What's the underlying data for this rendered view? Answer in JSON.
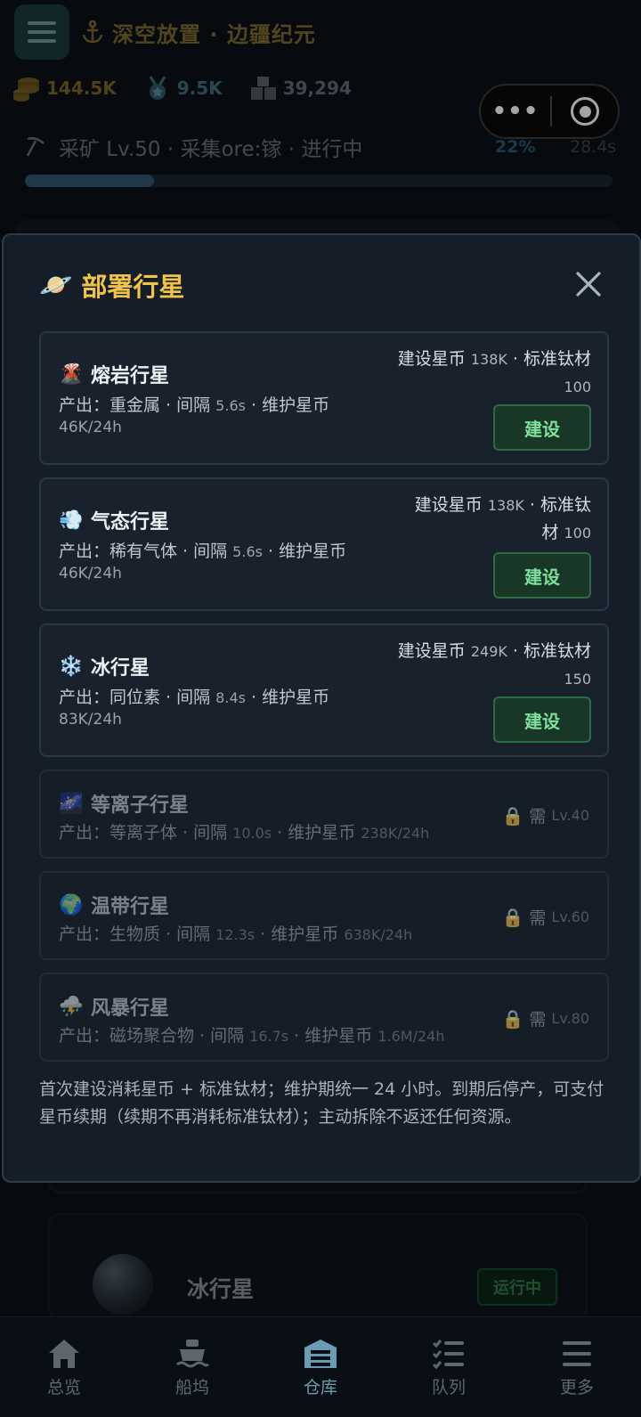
{
  "header": {
    "title": "深空放置 · 边疆纪元",
    "menu_icon": "menu-icon",
    "anchor_icon": "anchor-icon"
  },
  "resources": {
    "coins": "144.5K",
    "medals": "9.5K",
    "materials": "39,294"
  },
  "mini_capsule": {
    "more": "•••"
  },
  "mining": {
    "text": "采矿 Lv.50 · 采集ore:镓 · 进行中",
    "percent_label": "22%",
    "progress": 0.22,
    "time": "28.4s"
  },
  "modal": {
    "title": "部署行星",
    "title_icon": "🪐",
    "build_label": "建设",
    "footnote": "首次建设消耗星币 + 标准钛材；维护期统一 24 小时。到期后停产，可支付星币续期（续期不再消耗标准钛材）；主动拆除不返还任何资源。",
    "planets": [
      {
        "emoji": "🌋",
        "name": "熔岩行星",
        "output_prefix": "产出：重金属 · 间隔 ",
        "interval": "5.6s",
        "output_mid": " · 维护星币",
        "maintenance": "46K/24h",
        "cost_line1_a": "建设星币 ",
        "cost_line1_num": "138K",
        "cost_line1_b": " · 标准钛材",
        "cost_line2_a": "",
        "cost_line2_num": "100"
      },
      {
        "emoji": "💨",
        "name": "气态行星",
        "output_prefix": "产出：稀有气体 · 间隔 ",
        "interval": "5.6s",
        "output_mid": " · 维护星币",
        "maintenance": "46K/24h",
        "cost_line1_a": "建设星币 ",
        "cost_line1_num": "138K",
        "cost_line1_b": " · 标准钛",
        "cost_line2_a": "材 ",
        "cost_line2_num": "100"
      },
      {
        "emoji": "❄️",
        "name": "冰行星",
        "output_prefix": "产出：同位素 · 间隔 ",
        "interval": "8.4s",
        "output_mid": " · 维护星币",
        "maintenance": "83K/24h",
        "cost_line1_a": "建设星币 ",
        "cost_line1_num": "249K",
        "cost_line1_b": " · 标准钛材",
        "cost_line2_a": "",
        "cost_line2_num": "150"
      }
    ],
    "locked_planets": [
      {
        "emoji": "🌌",
        "name": "等离子行星",
        "output_prefix": "产出：等离子体 · 间隔 ",
        "interval": "10.0s",
        "output_mid": " · 维护星币 ",
        "maintenance": "238K/24h",
        "req_prefix": "需 ",
        "req_level": "Lv.40"
      },
      {
        "emoji": "🌍",
        "name": "温带行星",
        "output_prefix": "产出：生物质 · 间隔 ",
        "interval": "12.3s",
        "output_mid": " · 维护星币 ",
        "maintenance": "638K/24h",
        "req_prefix": "需 ",
        "req_level": "Lv.60"
      },
      {
        "emoji": "⛈️",
        "name": "风暴行星",
        "output_prefix": "产出：磁场聚合物 · 间隔 ",
        "interval": "16.7s",
        "output_mid": " · 维护星币 ",
        "maintenance": "1.6M/24h",
        "req_prefix": "需 ",
        "req_level": "Lv.80"
      }
    ],
    "lock_emoji": "🔒"
  },
  "background_card": {
    "name": "冰行星",
    "status": "运行中"
  },
  "bottom_nav": [
    {
      "label": "总览",
      "icon": "home-icon"
    },
    {
      "label": "船坞",
      "icon": "ship-icon"
    },
    {
      "label": "仓库",
      "icon": "warehouse-icon"
    },
    {
      "label": "队列",
      "icon": "checklist-icon"
    },
    {
      "label": "更多",
      "icon": "menu-icon"
    }
  ],
  "colors": {
    "accent_gold": "#f0c34a",
    "build_green": "#7ee09c",
    "active_nav": "#6a9cb3"
  }
}
